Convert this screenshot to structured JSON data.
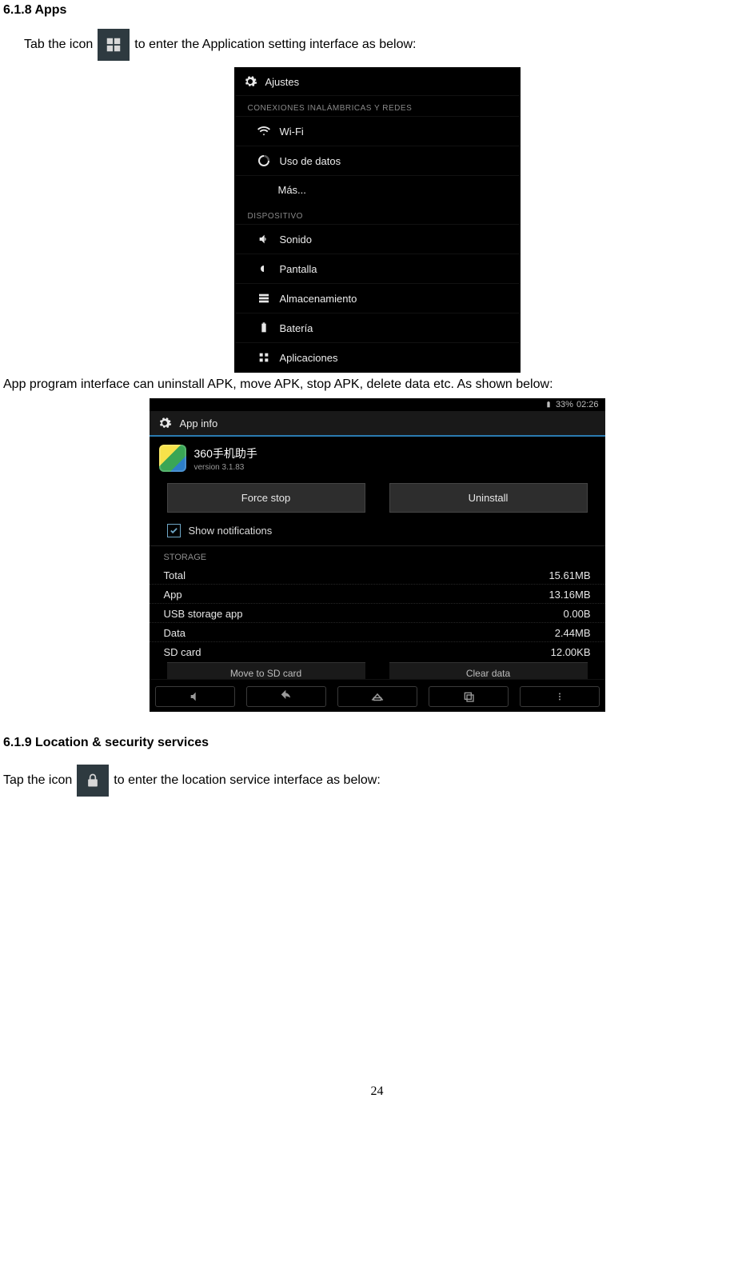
{
  "section1": {
    "heading": "6.1.8 Apps",
    "line_a": "Tab the icon",
    "line_b": "to enter the Application setting interface as below:"
  },
  "shot1": {
    "title": "Ajustes",
    "cat1": "CONEXIONES INALÁMBRICAS Y REDES",
    "items1": [
      "Wi-Fi",
      "Uso de datos",
      "Más..."
    ],
    "cat2": "DISPOSITIVO",
    "items2": [
      "Sonido",
      "Pantalla",
      "Almacenamiento",
      "Batería",
      "Aplicaciones"
    ]
  },
  "caption1": "App program interface can uninstall APK, move APK, stop APK, delete data etc. As shown below:",
  "shot2": {
    "status_batt": "33%",
    "status_time": "02:26",
    "title": "App info",
    "app_name": "360手机助手",
    "app_version": "version 3.1.83",
    "btn_force": "Force stop",
    "btn_uninstall": "Uninstall",
    "show_notif": "Show notifications",
    "cat_storage": "STORAGE",
    "rows": [
      {
        "k": "Total",
        "v": "15.61MB"
      },
      {
        "k": "App",
        "v": "13.16MB"
      },
      {
        "k": "USB storage app",
        "v": "0.00B"
      },
      {
        "k": "Data",
        "v": "2.44MB"
      },
      {
        "k": "SD card",
        "v": "12.00KB"
      }
    ],
    "partial_left": "Move to SD card",
    "partial_right": "Clear data"
  },
  "section2": {
    "heading": "6.1.9 Location & security services",
    "line_a": "Tap the icon",
    "line_b": "to enter the location service interface as below:"
  },
  "page_number": "24"
}
